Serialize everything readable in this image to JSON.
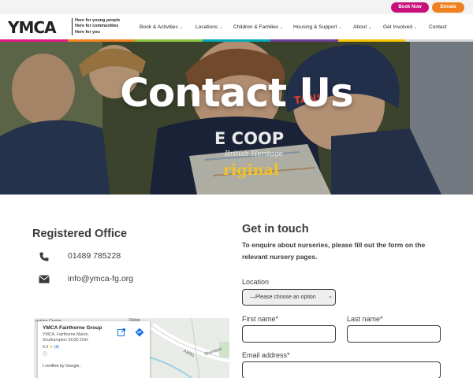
{
  "topbar": {
    "book_now": "Book Now",
    "donate": "Donate"
  },
  "header": {
    "logo": "YMCA",
    "tagline": [
      "Here for young people",
      "Here for communities",
      "Here for you"
    ],
    "nav": [
      {
        "label": "Book & Activities",
        "has_dropdown": true
      },
      {
        "label": "Locations",
        "has_dropdown": true
      },
      {
        "label": "Children & Families",
        "has_dropdown": true
      },
      {
        "label": "Housing & Support",
        "has_dropdown": true
      },
      {
        "label": "About",
        "has_dropdown": true
      },
      {
        "label": "Get Involved",
        "has_dropdown": true
      },
      {
        "label": "Contact",
        "has_dropdown": false
      }
    ],
    "rainbow_colors": [
      "#e2178a",
      "#f58220",
      "#8cc63f",
      "#00a7b5",
      "#6c3f99",
      "#f8c300",
      "#d6d6d6"
    ]
  },
  "hero": {
    "title": "Contact Us",
    "photo_text": {
      "hat": "TANS",
      "shirt_line1": "E COOP",
      "shirt_line2": "British Heritage",
      "shirt_line3": "riginal"
    }
  },
  "registered_office": {
    "title": "Registered Office",
    "phone_icon": "phone-icon",
    "phone": "01489 785228",
    "email_icon": "envelope-icon",
    "email": "info@ymca-fg.org"
  },
  "map": {
    "place_name": "YMCA Fairthorne Group",
    "address": "YMCA, Fairthorne Manor, Southampton SO30 2GH",
    "rating": "4.5",
    "review_count": "(8)",
    "verified_text": "t verified by Google,",
    "road_label": "A3051",
    "area_label": "Shamford",
    "label_centre": "mation Centre",
    "label_corner": "Ridge"
  },
  "contact_form": {
    "title": "Get in touch",
    "subtitle": "To enquire about nurseries, please fill out the form on the relevant nursery pages.",
    "location_label": "Location",
    "location_value": "—Please choose an option",
    "first_name_label": "First name*",
    "last_name_label": "Last name*",
    "email_label": "Email address*",
    "first_name_value": "",
    "last_name_value": "",
    "email_value": ""
  },
  "colors": {
    "book_now": "#c8107b",
    "donate": "#f07f1e",
    "text": "#3b3b3b"
  }
}
